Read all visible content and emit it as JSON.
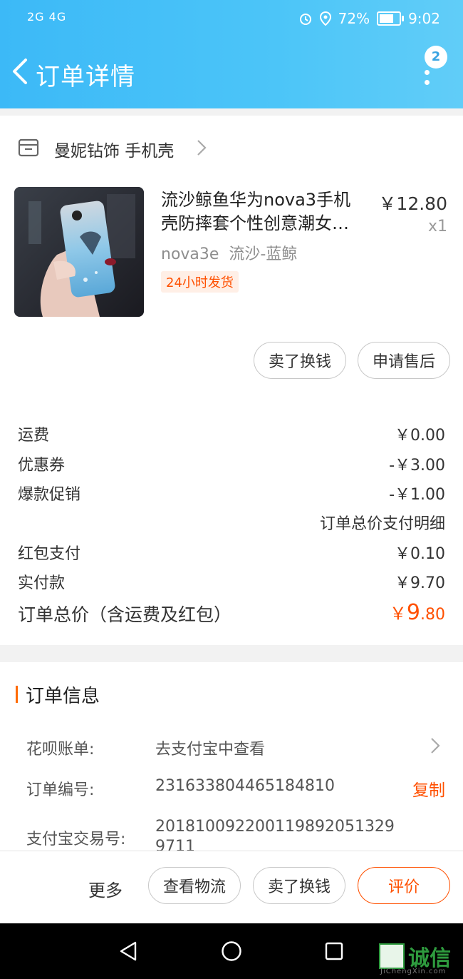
{
  "status_bar": {
    "network": "2G 4G",
    "alarm_icon": "alarm-icon",
    "location_icon": "location-icon",
    "battery": "72%",
    "battery_level": 0.72,
    "time": "9:02"
  },
  "header": {
    "title": "订单详情",
    "message_count": "2"
  },
  "shop": {
    "name": "曼妮钻饰 手机壳"
  },
  "product": {
    "title": "流沙鲸鱼华为nova3手机壳防摔套个性创意潮女…",
    "price": "￥12.80",
    "quantity": "x1",
    "spec": "nova3e  流沙-蓝鲸",
    "tag": "24小时发货"
  },
  "item_actions": {
    "sell": "卖了换钱",
    "after_sale": "申请售后"
  },
  "fees": {
    "shipping_label": "运费",
    "shipping_value": "￥0.00",
    "coupon_label": "优惠券",
    "coupon_value": "-￥3.00",
    "promo_label": "爆款促销",
    "promo_value": "-￥1.00",
    "detail_link": "订单总价支付明细",
    "redpacket_label": "红包支付",
    "redpacket_value": "￥0.10",
    "paid_label": "实付款",
    "paid_value": "￥9.70",
    "total_label": "订单总价（含运费及红包）",
    "total_currency": "￥",
    "total_int": "9",
    "total_dec": ".80"
  },
  "order_info": {
    "heading": "订单信息",
    "huabei_label": "花呗账单:",
    "huabei_value": "去支付宝中查看",
    "order_no_label": "订单编号:",
    "order_no_value": "231633804465184810",
    "copy_label": "复制",
    "alipay_no_label": "支付宝交易号:",
    "alipay_no_line1": "20181009220011989205132​9",
    "alipay_no_line2": "9711"
  },
  "bottom_actions": {
    "more": "更多",
    "logistics": "查看物流",
    "sell": "卖了换钱",
    "review": "评价"
  },
  "watermark": {
    "text": "诚信",
    "sub": "JiChengXin.com"
  },
  "colors": {
    "header_blue": "#3cb9f7",
    "accent_orange": "#ff5000"
  }
}
